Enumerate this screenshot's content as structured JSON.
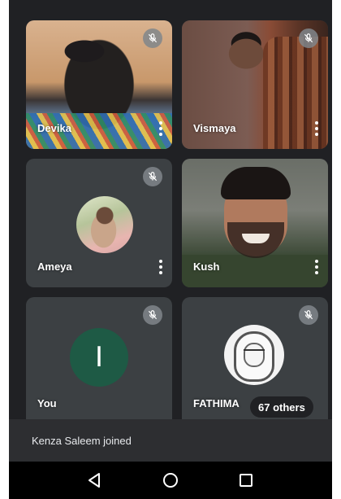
{
  "participants": [
    {
      "name": "Devika",
      "muted": true,
      "media": "video"
    },
    {
      "name": "Vismaya",
      "muted": true,
      "media": "video"
    },
    {
      "name": "Ameya",
      "muted": true,
      "media": "photo-avatar"
    },
    {
      "name": "Kush",
      "muted": false,
      "media": "video"
    },
    {
      "name": "You",
      "muted": true,
      "media": "initial-avatar",
      "initial": "I"
    },
    {
      "name": "FATHIMA",
      "muted": true,
      "media": "photo-avatar"
    }
  ],
  "others_chip": {
    "label": "67 others"
  },
  "toast": {
    "message": "Kenza Saleem joined"
  },
  "icons": {
    "mute": "mic-off-icon",
    "more": "more-vert-icon",
    "nav_back": "back-triangle-icon",
    "nav_home": "home-circle-icon",
    "nav_recents": "recents-square-icon"
  },
  "colors": {
    "background": "#202124",
    "tile": "#3c4043",
    "avatar_green": "#1e5a45",
    "mute_badge": "#80868b"
  }
}
